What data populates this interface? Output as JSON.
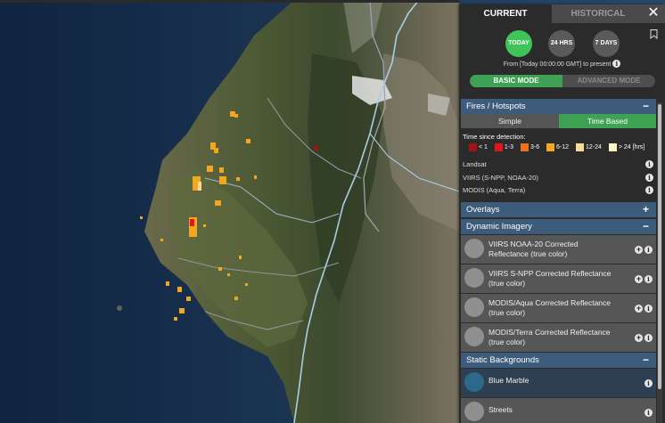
{
  "tabs": {
    "current": "CURRENT",
    "historical": "HISTORICAL"
  },
  "close_icon": "close-icon",
  "time_buttons": [
    {
      "label": "TODAY",
      "active": true
    },
    {
      "label": "24 HRS",
      "active": false
    },
    {
      "label": "7 DAYS",
      "active": false
    }
  ],
  "range_text": "From [Today 00:00:00 GMT] to present",
  "modes": {
    "basic": "BASIC MODE",
    "advanced": "ADVANCED MODE"
  },
  "fires": {
    "title": "Fires / Hotspots",
    "toggle": "−",
    "simple": "Simple",
    "time_based": "Time Based",
    "legend_title": "Time since detection:",
    "legend": [
      {
        "label": "< 1",
        "color": "#a31515"
      },
      {
        "label": "1-3",
        "color": "#e0161c"
      },
      {
        "label": "3-6",
        "color": "#f0701c"
      },
      {
        "label": "6-12",
        "color": "#f2a81e"
      },
      {
        "label": "12-24",
        "color": "#fbd896"
      },
      {
        "label": "> 24 [hrs]",
        "color": "#fdf6c4"
      }
    ],
    "sources": [
      "Landsat",
      "VIIRS (S-NPP, NOAA-20)",
      "MODIS (Aqua, Terra)"
    ]
  },
  "overlays": {
    "title": "Overlays",
    "toggle": "+"
  },
  "dynamic": {
    "title": "Dynamic Imagery",
    "toggle": "−",
    "layers": [
      {
        "line1": "VIIRS NOAA-20 Corrected",
        "line2": "Reflectance (true color)"
      },
      {
        "line1": "VIIRS S-NPP Corrected Reflectance",
        "line2": "(true color)"
      },
      {
        "line1": "MODIS/Aqua Corrected Reflectance",
        "line2": "(true color)"
      },
      {
        "line1": "MODIS/Terra Corrected Reflectance",
        "line2": "(true color)"
      }
    ]
  },
  "static": {
    "title": "Static Backgrounds",
    "toggle": "−",
    "layers": [
      "Blue Marble",
      "Streets"
    ]
  },
  "colors": {
    "accent_green": "#3fa153",
    "section_blue": "#3d5b7a",
    "river": "#a9cde6"
  }
}
